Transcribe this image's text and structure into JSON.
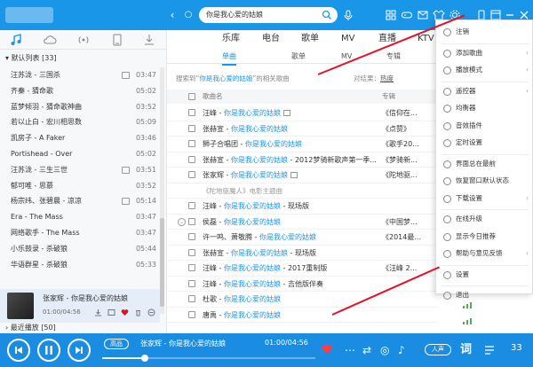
{
  "header": {
    "search_value": "你是我心爱的姑娘"
  },
  "sidebar": {
    "playlist_title": "默认列表",
    "playlist_count": "[33]",
    "items": [
      {
        "name": "汪苏泷 - 三国杀",
        "dur": "03:47",
        "mv": true
      },
      {
        "name": "齐秦 - 猜命歌",
        "dur": "05:02",
        "mv": false
      },
      {
        "name": "蓝梦倾羽 - 猜命歌神曲",
        "dur": "03:52",
        "mv": false
      },
      {
        "name": "若以止白 - 宏川相思数",
        "dur": "05:09",
        "mv": false
      },
      {
        "name": "凯房子 - A Faker",
        "dur": "03:46",
        "mv": false
      },
      {
        "name": "Portishead - Over",
        "dur": "05:02",
        "mv": false
      },
      {
        "name": "汪苏泷 - 三生三世",
        "dur": "03:51",
        "mv": true
      },
      {
        "name": "郁可唯 - 思慕",
        "dur": "03:52",
        "mv": false
      },
      {
        "name": "杨宗纬、张碧晨 - 凉凉",
        "dur": "05:14",
        "mv": true
      },
      {
        "name": "Era - The Mass",
        "dur": "03:47",
        "mv": false
      },
      {
        "name": "网络歌手 - The Mass",
        "dur": "03:47",
        "mv": false
      },
      {
        "name": "小乐鼓录 - 杀破狼",
        "dur": "05:44",
        "mv": false
      },
      {
        "name": "华语群星 - 杀破狼",
        "dur": "05:33",
        "mv": false
      }
    ],
    "now_playing": {
      "title": "张家辉 - 你是我心爱的姑娘",
      "time": "01:00/04:56"
    },
    "recent_label": "最近播放",
    "recent_count": "[50]"
  },
  "main": {
    "categories": [
      "乐库",
      "电台",
      "歌单",
      "MV",
      "直播",
      "KTV"
    ],
    "subtabs": [
      "单曲",
      "歌单",
      "MV",
      "专辑"
    ],
    "info_prefix": "搜索到“",
    "info_keyword": "你是我心爱的姑娘",
    "info_suffix": "”的相关歌曲",
    "sort_label": "对结果：",
    "sort_hot": "热度",
    "sort_relevant": "不需音域",
    "col_song": "歌曲名",
    "col_album": "专辑",
    "results": [
      {
        "artist": "汪峰 - ",
        "title": "你是我心爱的姑娘",
        "album": "《信仰在...",
        "mv": true,
        "sub": false
      },
      {
        "artist": "张赫宣 - ",
        "title": "你是我心爱的姑娘",
        "album": "《点赞》",
        "mv": false,
        "sub": false
      },
      {
        "artist": "狮子合唱团 - ",
        "title": "你是我心爱的姑娘",
        "album": "《歌手20...",
        "mv": false,
        "sub": false
      },
      {
        "artist": "张赫宣 - ",
        "title": "你是我心爱的姑娘",
        "extra": " - 2012梦骑新歌声第一季...",
        "album": "《梦骑新...",
        "mv": false,
        "sub": false
      },
      {
        "artist": "张家辉 - ",
        "title": "你是我心爱的姑娘",
        "album": "《陀地驱...",
        "mv": true,
        "sub": false
      },
      {
        "artist": "",
        "title": "《陀地驱魔人》电影主题曲",
        "album": "",
        "mv": false,
        "sub": true
      },
      {
        "artist": "汪峰 - ",
        "title": "你是我心爱的姑娘",
        "extra": " - 现场版",
        "album": "",
        "mv": false,
        "sub": false
      },
      {
        "artist": "侯磊 - ",
        "title": "你是我心爱的姑娘",
        "album": "《中国梦...",
        "mv": false,
        "sub": false
      },
      {
        "artist": "许一鸣、萧敬腾 - ",
        "title": "你是我心爱的姑娘",
        "album": "《2014最...",
        "mv": false,
        "sub": false
      },
      {
        "artist": "张赫宣 - ",
        "title": "你是我心爱的姑娘",
        "extra": " - 现场版",
        "album": "",
        "mv": false,
        "sub": false
      },
      {
        "artist": "汪峰 - ",
        "title": "你是我心爱的姑娘",
        "extra": " - 2017重制版",
        "album": "《汪峰 2...",
        "mv": false,
        "sub": false
      },
      {
        "artist": "汪峰 - ",
        "title": "你是我心爱的姑娘",
        "extra": " - 吉他版伴奏",
        "album": "",
        "mv": false,
        "sub": false
      },
      {
        "artist": "杜歌 - ",
        "title": "你是我心爱的姑娘",
        "album": "",
        "mv": false,
        "sub": false
      },
      {
        "artist": "唐禹 - ",
        "title": "你是我心爱的姑娘",
        "album": "",
        "mv": false,
        "sub": false
      }
    ]
  },
  "menu": {
    "items": [
      {
        "label": "注销",
        "arrow": false
      },
      {
        "label": "添加歌曲",
        "arrow": true
      },
      {
        "label": "播放模式",
        "arrow": true
      },
      {
        "label": "遥控器",
        "arrow": true
      },
      {
        "label": "均衡器",
        "arrow": false
      },
      {
        "label": "音效插件",
        "arrow": false
      },
      {
        "label": "定时设置",
        "arrow": false
      },
      {
        "label": "界面总在最前",
        "arrow": false
      },
      {
        "label": "恢复窗口默认状态",
        "arrow": false
      },
      {
        "label": "下载设置",
        "arrow": true
      },
      {
        "label": "在线升级",
        "arrow": false
      },
      {
        "label": "显示今日推荐",
        "arrow": false
      },
      {
        "label": "帮助与意见反馈",
        "arrow": true
      },
      {
        "label": "设置",
        "arrow": false
      },
      {
        "label": "退出",
        "arrow": false
      }
    ]
  },
  "player": {
    "quality": "高品",
    "title": "张家辉 - 你是我心爱的姑娘",
    "time": "01:00/04:56",
    "progress": 0.2,
    "mode_label": "人声",
    "lyrics_label": "词",
    "count": "33"
  },
  "colors": {
    "accent": "#1a96e8",
    "annotation": "#e0142a"
  }
}
